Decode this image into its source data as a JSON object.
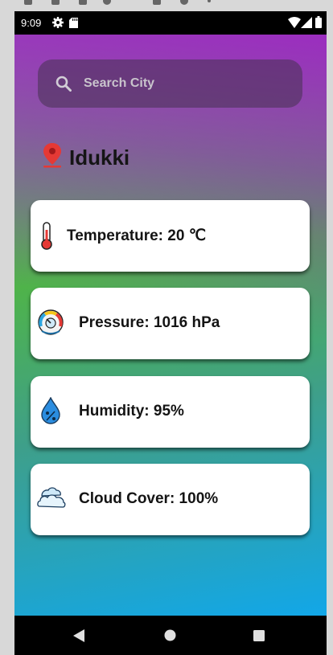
{
  "status_bar": {
    "time": "9:09",
    "icons": [
      "gear-icon",
      "sd-card-icon",
      "wifi-icon",
      "signal-icon",
      "battery-icon"
    ]
  },
  "search": {
    "placeholder": "Search City",
    "icon": "search-icon"
  },
  "location": {
    "city": "Idukki",
    "icon": "location-pin-icon",
    "pin_color": "#e53935"
  },
  "weather": {
    "temperature_label": "Temperature: 20 ℃",
    "pressure_label": "Pressure: 1016 hPa",
    "humidity_label": "Humidity: 95%",
    "cloud_label": "Cloud Cover: 100%"
  },
  "icons": {
    "temperature": "thermometer-icon",
    "pressure": "gauge-icon",
    "humidity": "water-drop-icon",
    "cloud": "cloud-icon"
  },
  "navigation": {
    "buttons": [
      "back-icon",
      "home-icon",
      "recents-icon"
    ]
  },
  "colors": {
    "card_bg": "#ffffff",
    "text_dark": "#141414",
    "placeholder_text": "#c9c4cc"
  }
}
